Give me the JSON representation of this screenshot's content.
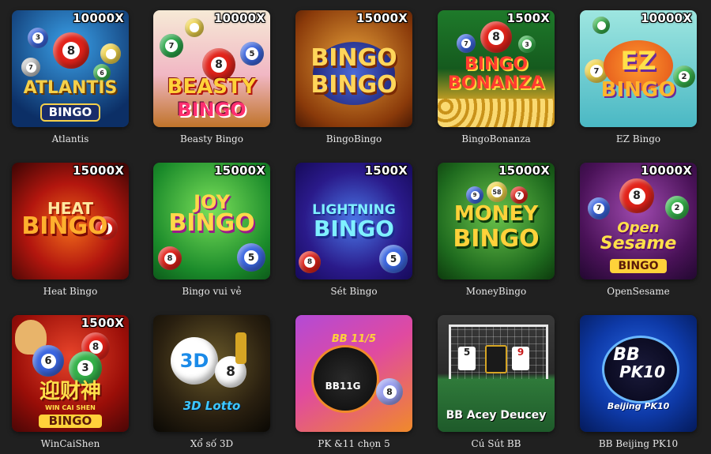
{
  "games": [
    {
      "name": "Atlantis",
      "multiplier": "10000X",
      "logo_lines": [
        "ATLANTIS",
        "BINGO"
      ],
      "bg": [
        "#1d6fb8",
        "#0c2f66"
      ],
      "accent": "#f5d04a"
    },
    {
      "name": "Beasty Bingo",
      "multiplier": "10000X",
      "logo_lines": [
        "BEASTY",
        "BINGO"
      ],
      "bg": [
        "#f4e6d0",
        "#e26b8d"
      ],
      "accent": "#ff2f6f"
    },
    {
      "name": "BingoBingo",
      "multiplier": "15000X",
      "logo_lines": [
        "BINGO",
        "BINGO"
      ],
      "bg": [
        "#d9822b",
        "#6a2a0a"
      ],
      "accent": "#ffd65a"
    },
    {
      "name": "BingoBonanza",
      "multiplier": "1500X",
      "logo_lines": [
        "BINGO",
        "BONANZA"
      ],
      "bg": [
        "#1e7a2a",
        "#d6a524"
      ],
      "accent": "#ff3c2f"
    },
    {
      "name": "EZ Bingo",
      "multiplier": "10000X",
      "logo_lines": [
        "EZ",
        "BINGO"
      ],
      "bg": [
        "#7fd6d4",
        "#3aa6b5"
      ],
      "accent": "#ffb62e"
    },
    {
      "name": "Heat Bingo",
      "multiplier": "15000X",
      "logo_lines": [
        "HEAT",
        "BINGO"
      ],
      "bg": [
        "#b3160e",
        "#3a0504"
      ],
      "accent": "#ffb02e"
    },
    {
      "name": "Bingo vui vẻ",
      "multiplier": "15000X",
      "logo_lines": [
        "JOY",
        "BINGO"
      ],
      "bg": [
        "#48c24a",
        "#0d6a2a"
      ],
      "accent": "#ffd84a"
    },
    {
      "name": "Sét Bingo",
      "multiplier": "1500X",
      "logo_lines": [
        "LIGHTNING",
        "BINGO"
      ],
      "bg": [
        "#3a58d6",
        "#160a5a"
      ],
      "accent": "#7ff0ff"
    },
    {
      "name": "MoneyBingo",
      "multiplier": "15000X",
      "logo_lines": [
        "MONEY",
        "BINGO"
      ],
      "bg": [
        "#3a9a2a",
        "#134d14"
      ],
      "accent": "#ffd23a"
    },
    {
      "name": "OpenSesame",
      "multiplier": "10000X",
      "logo_lines": [
        "Open",
        "Sesame",
        "BINGO"
      ],
      "bg": [
        "#6a1f7a",
        "#2a0838"
      ],
      "accent": "#ffd23a"
    },
    {
      "name": "WinCaiShen",
      "multiplier": "1500X",
      "logo_lines": [
        "迎财神",
        "WIN CAI SHEN",
        "BINGO"
      ],
      "bg": [
        "#b8170f",
        "#4a0606"
      ],
      "accent": "#ffd23a"
    },
    {
      "name": "Xổ số 3D",
      "multiplier": "",
      "logo_lines": [
        "3D",
        "3D Lotto"
      ],
      "bg": [
        "#2a2416",
        "#0a0804"
      ],
      "accent": "#3ec8ff"
    },
    {
      "name": "PK &11 chọn 5",
      "multiplier": "",
      "logo_lines": [
        "BB 11/5",
        "BB11G"
      ],
      "bg": [
        "#d64ab8",
        "#f08a2a"
      ],
      "accent": "#ffffff"
    },
    {
      "name": "Cú Sút BB",
      "multiplier": "",
      "logo_lines": [
        "BB Acey Deucey"
      ],
      "bg": [
        "#2a2a2a",
        "#2f7a3a"
      ],
      "accent": "#ffffff"
    },
    {
      "name": "BB Beijing PK10",
      "multiplier": "",
      "logo_lines": [
        "BB",
        "PK10",
        "Beijing PK10"
      ],
      "bg": [
        "#0e3aa8",
        "#041a5a"
      ],
      "accent": "#ffffff"
    }
  ]
}
